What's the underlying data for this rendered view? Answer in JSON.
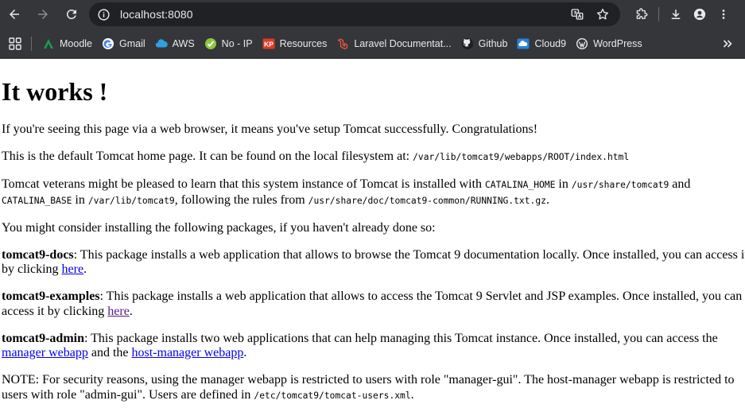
{
  "browser": {
    "url": "localhost:8080",
    "bookmarks": [
      {
        "label": "Moodle",
        "icon": "moodle-icon"
      },
      {
        "label": "Gmail",
        "icon": "google-icon"
      },
      {
        "label": "AWS",
        "icon": "aws-cloud-icon"
      },
      {
        "label": "No - IP",
        "icon": "noip-icon"
      },
      {
        "label": "Resources",
        "icon": "kp-icon"
      },
      {
        "label": "Laravel Documentat...",
        "icon": "laravel-icon"
      },
      {
        "label": "Github",
        "icon": "github-icon"
      },
      {
        "label": "Cloud9",
        "icon": "cloud9-icon"
      },
      {
        "label": "WordPress",
        "icon": "wordpress-icon"
      }
    ]
  },
  "page": {
    "heading": "It works !",
    "p1": "If you're seeing this page via a web browser, it means you've setup Tomcat successfully. Congratulations!",
    "p2_text": "This is the default Tomcat home page. It can be found on the local filesystem at: ",
    "p2_code": "/var/lib/tomcat9/webapps/ROOT/index.html",
    "p3_a": "Tomcat veterans might be pleased to learn that this system instance of Tomcat is installed with ",
    "p3_code1": "CATALINA_HOME",
    "p3_b": " in ",
    "p3_code2": "/usr/share/tomcat9",
    "p3_c": " and",
    "p3_code3": "CATALINA_BASE",
    "p3_d": " in ",
    "p3_code4": "/var/lib/tomcat9",
    "p3_e": ", following the rules from ",
    "p3_code5": "/usr/share/doc/tomcat9-common/RUNNING.txt.gz",
    "p3_f": ".",
    "p4": "You might consider installing the following packages, if you haven't already done so:",
    "docs_name": "tomcat9-docs",
    "docs_text": ": This package installs a web application that allows to browse the Tomcat 9 documentation locally. Once installed, you can access it",
    "docs_text2": "by clicking ",
    "docs_link": "here",
    "docs_end": ".",
    "examples_name": "tomcat9-examples",
    "examples_text": ": This package installs a web application that allows to access the Tomcat 9 Servlet and JSP examples. Once installed, you can",
    "examples_text2": "access it by clicking ",
    "examples_link": "here",
    "examples_end": ".",
    "admin_name": "tomcat9-admin",
    "admin_text": ": This package installs two web applications that can help managing this Tomcat instance. Once installed, you can access the",
    "admin_link1": "manager webapp",
    "admin_mid": " and the ",
    "admin_link2": "host-manager webapp",
    "admin_end": ".",
    "note_text": "NOTE: For security reasons, using the manager webapp is restricted to users with role \"manager-gui\". The host-manager webapp is restricted to",
    "note_text2": "users with role \"admin-gui\". Users are defined in ",
    "note_code": "/etc/tomcat9/tomcat-users.xml",
    "note_end": "."
  }
}
